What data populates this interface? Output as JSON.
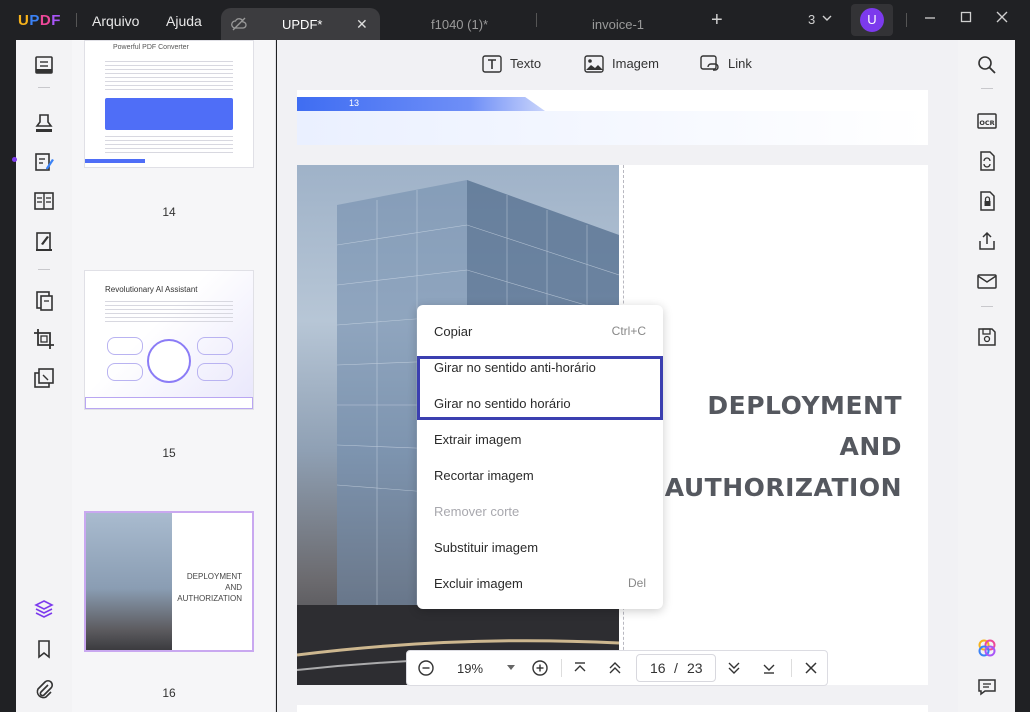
{
  "app": {
    "logo": "UPDF"
  },
  "menu": {
    "file": "Arquivo",
    "help": "Ajuda"
  },
  "tabs": [
    {
      "label": "UPDF*",
      "active": true
    },
    {
      "label": "f1040 (1)*",
      "active": false
    },
    {
      "label": "invoice-1",
      "active": false
    }
  ],
  "titlebar": {
    "window_count": "3",
    "avatar_letter": "U"
  },
  "toolbar": {
    "text_label": "Texto",
    "image_label": "Imagem",
    "link_label": "Link"
  },
  "thumbnails": [
    {
      "page": "14",
      "title": "Powerful PDF Converter"
    },
    {
      "page": "15",
      "title": "Revolutionary AI Assistant"
    },
    {
      "page": "16",
      "title": "DEPLOYMENT AND AUTHORIZATION"
    }
  ],
  "page13": {
    "number_tag": "13"
  },
  "page16": {
    "title_line1": "DEPLOYMENT AND",
    "title_line2": "AUTHORIZATION"
  },
  "context_menu": {
    "items": [
      {
        "label": "Copiar",
        "shortcut": "Ctrl+C",
        "disabled": false
      },
      {
        "label": "Girar no sentido anti-horário",
        "shortcut": "",
        "disabled": false
      },
      {
        "label": "Girar no sentido horário",
        "shortcut": "",
        "disabled": false
      },
      {
        "label": "Extrair imagem",
        "shortcut": "",
        "disabled": false
      },
      {
        "label": "Recortar imagem",
        "shortcut": "",
        "disabled": false
      },
      {
        "label": "Remover corte",
        "shortcut": "",
        "disabled": true
      },
      {
        "label": "Substituir imagem",
        "shortcut": "",
        "disabled": false
      },
      {
        "label": "Excluir imagem",
        "shortcut": "Del",
        "disabled": false
      }
    ]
  },
  "zoom": {
    "level": "19%",
    "current_page": "16",
    "separator": "/",
    "total_pages": "23"
  },
  "colors": {
    "accent": "#7c3aed",
    "highlight_border": "#3b3fb0",
    "brand_blue": "#3b82f6"
  }
}
